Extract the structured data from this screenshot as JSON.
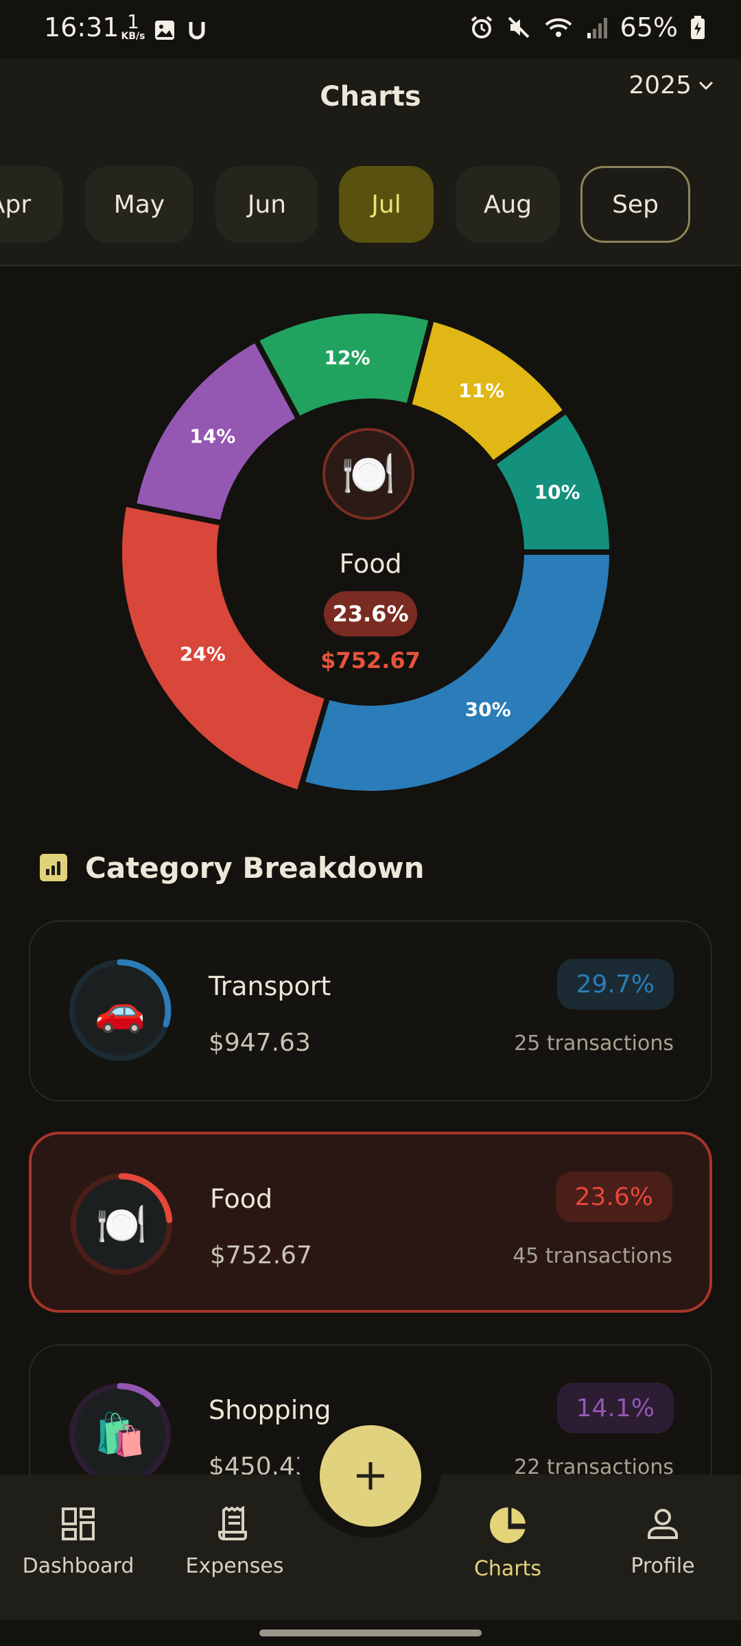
{
  "status_bar": {
    "time": "16:31",
    "net_speed_value": "1",
    "net_speed_unit": "KB/s",
    "battery": "65%"
  },
  "header": {
    "title": "Charts",
    "year": "2025",
    "months": [
      {
        "label": "Apr"
      },
      {
        "label": "May"
      },
      {
        "label": "Jun"
      },
      {
        "label": "Jul",
        "state": "selected"
      },
      {
        "label": "Aug"
      },
      {
        "label": "Sep",
        "state": "current"
      }
    ]
  },
  "chart_data": {
    "type": "pie",
    "style": "donut",
    "slices": [
      {
        "category": "Transport",
        "label": "30%",
        "value": 29.7,
        "color": "#2a7db8"
      },
      {
        "category": "Food",
        "label": "24%",
        "value": 23.6,
        "color": "#d8473a"
      },
      {
        "category": "Shopping",
        "label": "14%",
        "value": 14.1,
        "color": "#9457b2"
      },
      {
        "category": "",
        "label": "12%",
        "value": 12,
        "color": "#21a35f"
      },
      {
        "category": "",
        "label": "11%",
        "value": 11,
        "color": "#e0b714"
      },
      {
        "category": "",
        "label": "10%",
        "value": 10,
        "color": "#13917c"
      }
    ],
    "center": {
      "icon": "plate-icon",
      "name": "Food",
      "percent": "23.6%",
      "amount": "$752.67"
    }
  },
  "breakdown": {
    "title": "Category Breakdown",
    "items": [
      {
        "name": "Transport",
        "amount": "$947.63",
        "percent": "29.7%",
        "transactions": "25 transactions",
        "fraction": 0.297,
        "color": "#2a7db8",
        "icon": "car-icon",
        "emoji": "🚗"
      },
      {
        "name": "Food",
        "amount": "$752.67",
        "percent": "23.6%",
        "transactions": "45 transactions",
        "fraction": 0.236,
        "color": "#e5473a",
        "icon": "plate-icon",
        "emoji": "🍽️",
        "active": true
      },
      {
        "name": "Shopping",
        "amount": "$450.43",
        "percent": "14.1%",
        "transactions": "22 transactions",
        "fraction": 0.141,
        "color": "#9457b2",
        "icon": "shopping-bags-icon",
        "emoji": "🛍️"
      }
    ]
  },
  "nav": {
    "items": [
      {
        "label": "Dashboard",
        "icon": "dashboard-icon"
      },
      {
        "label": "Expenses",
        "icon": "receipt-icon"
      },
      {
        "label": "Charts",
        "icon": "pie-chart-icon",
        "active": true
      },
      {
        "label": "Profile",
        "icon": "person-icon"
      }
    ],
    "fab_icon": "plus-icon"
  }
}
